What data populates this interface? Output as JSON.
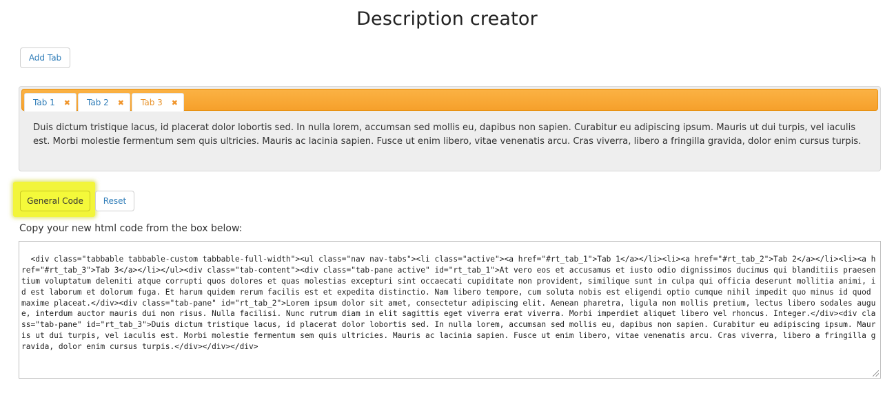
{
  "page": {
    "title": "Description creator"
  },
  "toolbar": {
    "add_tab_label": "Add Tab"
  },
  "tabs": [
    {
      "label": "Tab 1",
      "close": "✖"
    },
    {
      "label": "Tab 2",
      "close": "✖"
    },
    {
      "label": "Tab 3",
      "close": "✖"
    }
  ],
  "active_tab": "Tab 3",
  "tab_content": "Duis dictum tristique lacus, id placerat dolor lobortis sed. In nulla lorem, accumsan sed mollis eu, dapibus non sapien. Curabitur eu adipiscing ipsum. Mauris ut dui turpis, vel iaculis est. Morbi molestie fermentum sem quis ultricies. Mauris ac lacinia sapien. Fusce ut enim libero, vitae venenatis arcu. Cras viverra, libero a fringilla gravida, dolor enim cursus turpis.",
  "actions": {
    "generate_label": "General Code",
    "reset_label": "Reset"
  },
  "output": {
    "label": "Copy your new html code from the box below:",
    "code": "<div class=\"tabbable tabbable-custom tabbable-full-width\"><ul class=\"nav nav-tabs\"><li class=\"active\"><a href=\"#rt_tab_1\">Tab 1</a></li><li><a href=\"#rt_tab_2\">Tab 2</a></li><li><a href=\"#rt_tab_3\">Tab 3</a></li></ul><div class=\"tab-content\"><div class=\"tab-pane active\" id=\"rt_tab_1\">At vero eos et accusamus et iusto odio dignissimos ducimus qui blanditiis praesentium voluptatum deleniti atque corrupti quos dolores et quas molestias excepturi sint occaecati cupiditate non provident, similique sunt in culpa qui officia deserunt mollitia animi, id est laborum et dolorum fuga. Et harum quidem rerum facilis est et expedita distinctio. Nam libero tempore, cum soluta nobis est eligendi optio cumque nihil impedit quo minus id quod maxime placeat.</div><div class=\"tab-pane\" id=\"rt_tab_2\">Lorem ipsum dolor sit amet, consectetur adipiscing elit. Aenean pharetra, ligula non mollis pretium, lectus libero sodales augue, interdum auctor mauris dui non risus. Nulla facilisi. Nunc rutrum diam in elit sagittis eget viverra erat viverra. Morbi imperdiet aliquet libero vel rhoncus. Integer.</div><div class=\"tab-pane\" id=\"rt_tab_3\">Duis dictum tristique lacus, id placerat dolor lobortis sed. In nulla lorem, accumsan sed mollis eu, dapibus non sapien. Curabitur eu adipiscing ipsum. Mauris ut dui turpis, vel iaculis est. Morbi molestie fermentum sem quis ultricies. Mauris ac lacinia sapien. Fusce ut enim libero, vitae venenatis arcu. Cras viverra, libero a fringilla gravida, dolor enim cursus turpis.</div></div></div>"
  },
  "colors": {
    "tabbar_orange": "#f6a02b",
    "link_blue": "#2e7cb8",
    "highlight_yellow": "#f2f53a"
  }
}
